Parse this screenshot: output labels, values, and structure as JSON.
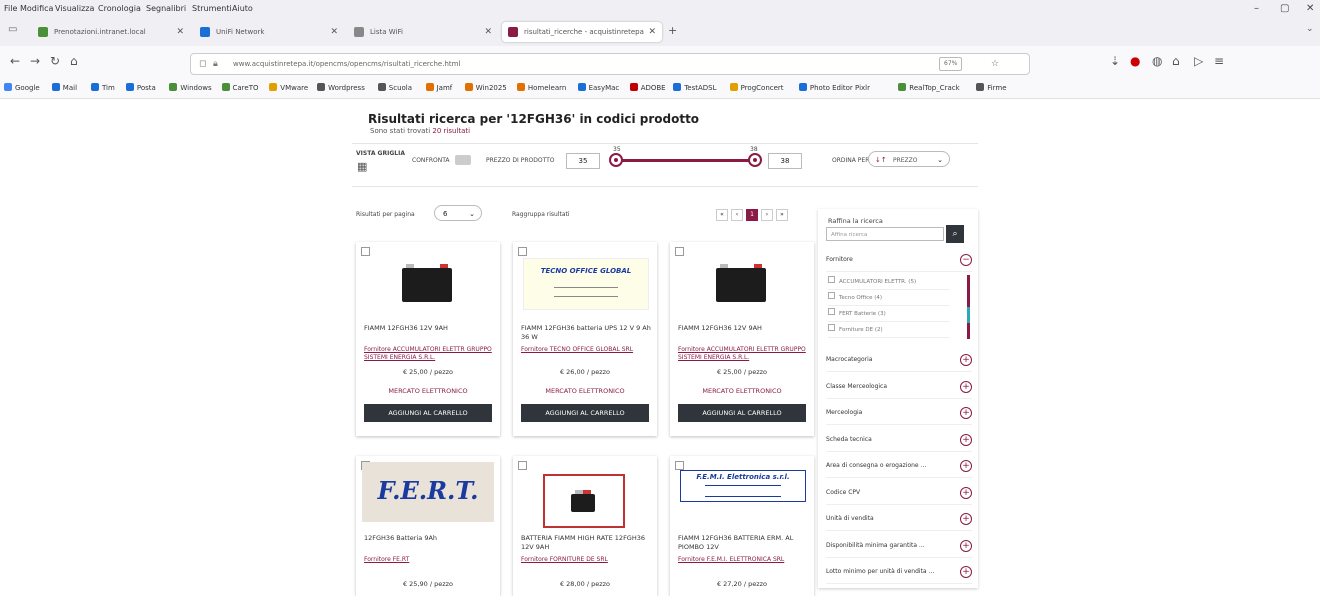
{
  "menubar": [
    "File",
    "Modifica",
    "Visualizza",
    "Cronologia",
    "Segnalibri",
    "Strumenti",
    "Aiuto"
  ],
  "tabs": [
    {
      "label": "Prenotazioni.intranet.local",
      "color": "#4a8f3a"
    },
    {
      "label": "UniFi Network",
      "color": "#1a6fd6"
    },
    {
      "label": "Lista WiFi",
      "color": "#888888"
    },
    {
      "label": "risultati_ricerche - acquistinretepa",
      "color": "#8b1a45"
    }
  ],
  "url": "www.acquistinretepa.it/opencms/opencms/risultati_ricerche.html",
  "zoom": "67%",
  "bookmarks": [
    {
      "label": "Google",
      "color": "#4285f4"
    },
    {
      "label": "Mail",
      "color": "#1a6fd6"
    },
    {
      "label": "Tim",
      "color": "#1a6fd6"
    },
    {
      "label": "Posta",
      "color": "#1a6fd6"
    },
    {
      "label": "Windows",
      "color": "#4a8f3a"
    },
    {
      "label": "CareTO",
      "color": "#4a8f3a"
    },
    {
      "label": "VMware",
      "color": "#e0a000"
    },
    {
      "label": "Wordpress",
      "color": "#555555"
    },
    {
      "label": "Scuola",
      "color": "#555555"
    },
    {
      "label": "Jamf",
      "color": "#e07000"
    },
    {
      "label": "Win2025",
      "color": "#e07000"
    },
    {
      "label": "Homelearn",
      "color": "#e07000"
    },
    {
      "label": "EasyMac",
      "color": "#1a6fd6"
    },
    {
      "label": "ADOBE",
      "color": "#c00000"
    },
    {
      "label": "TestADSL",
      "color": "#1a6fd6"
    },
    {
      "label": "ProgConcert",
      "color": "#e0a000"
    },
    {
      "label": "Photo Editor Pixlr",
      "color": "#1a6fd6"
    },
    {
      "label": "RealTop_Crack",
      "color": "#4a8f3a"
    },
    {
      "label": "Firme",
      "color": "#555555"
    }
  ],
  "page": {
    "title": "Risultati ricerca per '12FGH36' in codici prodotto",
    "subtitle_prefix": "Sono stati trovati",
    "subtitle_count": "20 risultati",
    "vista_label": "VISTA GRIGLIA",
    "confronta_label": "CONFRONTA",
    "prezzo_label": "PREZZO DI PRODOTTO",
    "price_min": "35",
    "price_max": "38",
    "ordina_label": "ORDINA PER",
    "ordina_value": "PREZZO",
    "per_page_label": "Risultati per pagina",
    "per_page_value": "6",
    "raggruppa_label": "Raggruppa risultati",
    "pages": [
      "«",
      "‹",
      "1",
      "›",
      "»"
    ],
    "current_page_index": 2
  },
  "products": [
    {
      "name": "FIAMM 12FGH36 12V 9AH",
      "seller": "Fornitore ACCUMULATORI ELETTR GRUPPO SISTEMI ENERGIA S.R.L.",
      "price": "€ 25,00 / pezzo",
      "store": "MERCATO ELETTRONICO",
      "button": "AGGIUNGI AL CARRELLO",
      "logo": ""
    },
    {
      "name": "FIAMM 12FGH36 batteria UPS 12 V 9 Ah 36 W",
      "seller": "Fornitore TECNO OFFICE GLOBAL SRL",
      "price": "€ 26,00 / pezzo",
      "store": "MERCATO ELETTRONICO",
      "button": "AGGIUNGI AL CARRELLO",
      "logo": "TECNO OFFICE GLOBAL"
    },
    {
      "name": "FIAMM 12FGH36 12V 9AH",
      "seller": "Fornitore ACCUMULATORI ELETTR GRUPPO SISTEMI ENERGIA S.R.L.",
      "price": "€ 25,00 / pezzo",
      "store": "MERCATO ELETTRONICO",
      "button": "AGGIUNGI AL CARRELLO",
      "logo": ""
    },
    {
      "name": "12FGH36 Batteria 9Ah",
      "seller": "Fornitore FE.RT",
      "price": "€ 25,90 / pezzo",
      "logo": "F.E.R.T."
    },
    {
      "name": "BATTERIA FIAMM HIGH RATE 12FGH36 12V 9AH",
      "seller": "Fornitore FORNITURE DE SRL",
      "price": "€ 28,00 / pezzo",
      "logo": ""
    },
    {
      "name": "FIAMM 12FGH36 BATTERIA ERM. AL PIOMBO 12V",
      "seller": "Fornitore F.E.M.I. ELETTRONICA SRL",
      "price": "€ 27,20 / pezzo",
      "logo": "F.E.M.I. Elettronica s.r.l."
    }
  ],
  "sidebar": {
    "refine_label": "Raffina la ricerca",
    "search_placeholder": "Affina ricerca",
    "fornitore_label": "Fornitore",
    "fornitori": [
      "ACCUMULATORI ELETTR. (5)",
      "Tecno Office (4)",
      "FERT Batterie (3)",
      "Forniture DE (2)"
    ],
    "filters": [
      "Macrocategoria",
      "Classe Merceologica",
      "Merceologia",
      "Scheda tecnica",
      "Area di consegna o erogazione ...",
      "Codice CPV",
      "Unità di vendita",
      "Disponibilità minima garantita ...",
      "Lotto minimo per unità di vendita ..."
    ]
  }
}
